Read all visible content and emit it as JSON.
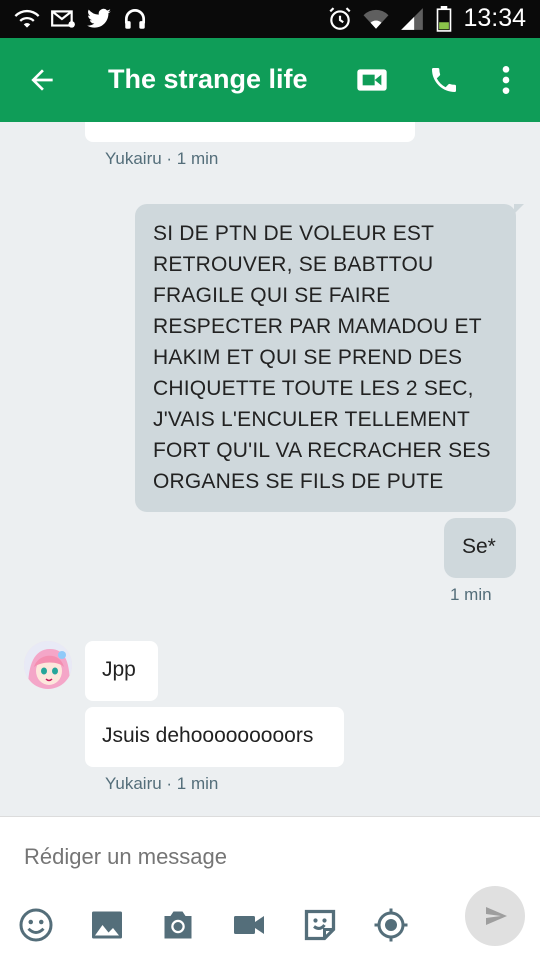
{
  "status_bar": {
    "time": "13:34",
    "icons": [
      "wifi-icon",
      "sms-icon",
      "twitter-icon",
      "headset-icon",
      "alarm-icon",
      "wifi-signal-icon",
      "cell-signal-icon",
      "battery-icon"
    ]
  },
  "app_bar": {
    "title": "The strange life",
    "icons": [
      "back-arrow-icon",
      "video-call-icon",
      "phone-icon",
      "more-vert-icon"
    ],
    "color": "#0f9d58"
  },
  "messages": [
    {
      "side": "incoming",
      "text": "",
      "partial": true
    },
    {
      "side": "meta",
      "text": "Yukairu · 1 min"
    },
    {
      "side": "outgoing",
      "lines": [
        "SI DE PTN DE VOLEUR EST",
        "RETROUVER, SE BABTTOU",
        "FRAGILE QUI SE FAIRE",
        "RESPECTER PAR MAMADOU ET",
        "HAKIM ET QUI SE PREND DES",
        "CHIQUETTE TOUTE LES 2 SEC,",
        "J'VAIS L'ENCULER TELLEMENT",
        "FORT QU'IL VA RECRACHER SES",
        "ORGANES SE FILS DE PUTE"
      ]
    },
    {
      "side": "outgoing",
      "text": "Se*"
    },
    {
      "side": "meta",
      "text": "1 min"
    },
    {
      "side": "incoming",
      "text": "Jpp"
    },
    {
      "side": "incoming",
      "text": "Jsuis dehooooooooors"
    },
    {
      "side": "meta",
      "text": "Yukairu · 1 min"
    }
  ],
  "composer": {
    "placeholder": "Rédiger un message",
    "tools": [
      "emoji-icon",
      "image-icon",
      "camera-icon",
      "video-icon",
      "sticker-icon",
      "location-icon"
    ],
    "send_icon": "send-icon"
  }
}
